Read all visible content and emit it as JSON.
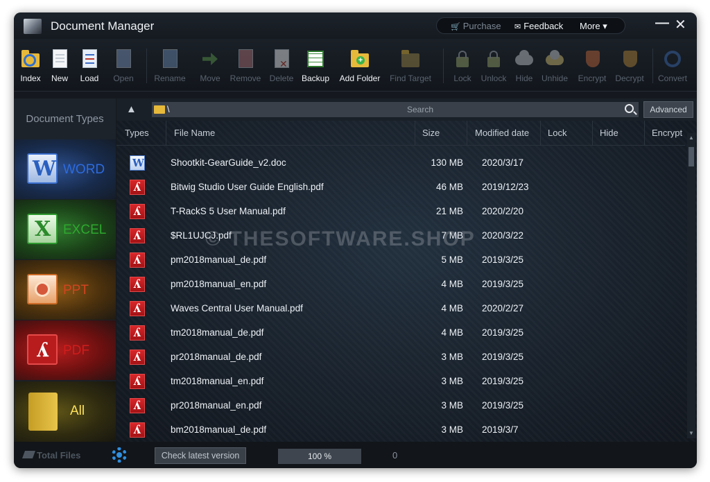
{
  "window": {
    "title": "Document Manager"
  },
  "top_menu": {
    "purchase": "Purchase",
    "feedback": "Feedback",
    "more": "More ▾"
  },
  "window_controls": {
    "minimize": "—",
    "close": "✕"
  },
  "toolbar": {
    "index": "Index",
    "new": "New",
    "load": "Load",
    "open": "Open",
    "rename": "Rename",
    "move": "Move",
    "remove": "Remove",
    "delete": "Delete",
    "backup": "Backup",
    "add_folder": "Add Folder",
    "find_target": "Find Target",
    "lock": "Lock",
    "unlock": "Unlock",
    "hide": "Hide",
    "unhide": "Unhide",
    "encrypt": "Encrypt",
    "decrypt": "Decrypt",
    "convert": "Convert"
  },
  "sidebar": {
    "title": "Document Types",
    "categories": [
      {
        "label": "WORD",
        "icon": "word-icon"
      },
      {
        "label": "EXCEL",
        "icon": "excel-icon"
      },
      {
        "label": "PPT",
        "icon": "ppt-icon"
      },
      {
        "label": "PDF",
        "icon": "pdf-icon"
      },
      {
        "label": "All",
        "icon": "folder-icon"
      }
    ]
  },
  "path": {
    "value": "\\"
  },
  "search": {
    "placeholder": "Search",
    "advanced": "Advanced"
  },
  "table": {
    "columns": [
      "Types",
      "File Name",
      "Size",
      "Modified date",
      "Lock",
      "Hide",
      "Encrypt"
    ],
    "rows": [
      {
        "type": "doc",
        "name": "Shootkit-GearGuide_v2.doc",
        "size": "130 MB",
        "date": "2020/3/17"
      },
      {
        "type": "pdf",
        "name": "Bitwig Studio User Guide English.pdf",
        "size": "46 MB",
        "date": "2019/12/23"
      },
      {
        "type": "pdf",
        "name": "T-RackS 5 User Manual.pdf",
        "size": "21 MB",
        "date": "2020/2/20"
      },
      {
        "type": "pdf",
        "name": "$RL1UJCJ.pdf",
        "size": "7 MB",
        "date": "2020/3/22"
      },
      {
        "type": "pdf",
        "name": "pm2018manual_de.pdf",
        "size": "5 MB",
        "date": "2019/3/25"
      },
      {
        "type": "pdf",
        "name": "pm2018manual_en.pdf",
        "size": "4 MB",
        "date": "2019/3/25"
      },
      {
        "type": "pdf",
        "name": "Waves Central User Manual.pdf",
        "size": "4 MB",
        "date": "2020/2/27"
      },
      {
        "type": "pdf",
        "name": "tm2018manual_de.pdf",
        "size": "4 MB",
        "date": "2019/3/25"
      },
      {
        "type": "pdf",
        "name": "pr2018manual_de.pdf",
        "size": "3 MB",
        "date": "2019/3/25"
      },
      {
        "type": "pdf",
        "name": "tm2018manual_en.pdf",
        "size": "3 MB",
        "date": "2019/3/25"
      },
      {
        "type": "pdf",
        "name": "pr2018manual_en.pdf",
        "size": "3 MB",
        "date": "2019/3/25"
      },
      {
        "type": "pdf",
        "name": "bm2018manual_de.pdf",
        "size": "3 MB",
        "date": "2019/3/7"
      }
    ]
  },
  "watermark": "© THESOFTWARE.SHOP",
  "status": {
    "total_files": "Total Files",
    "check_version": "Check latest version",
    "progress_text": "100 %",
    "progress_value": 1.0,
    "count": "0"
  },
  "colors": {
    "accent": "#2f8fe0",
    "pdf": "#d21c1c",
    "word": "#2c6be0",
    "excel": "#2ea82e",
    "ppt": "#d2441f",
    "all": "#ffe25a"
  }
}
